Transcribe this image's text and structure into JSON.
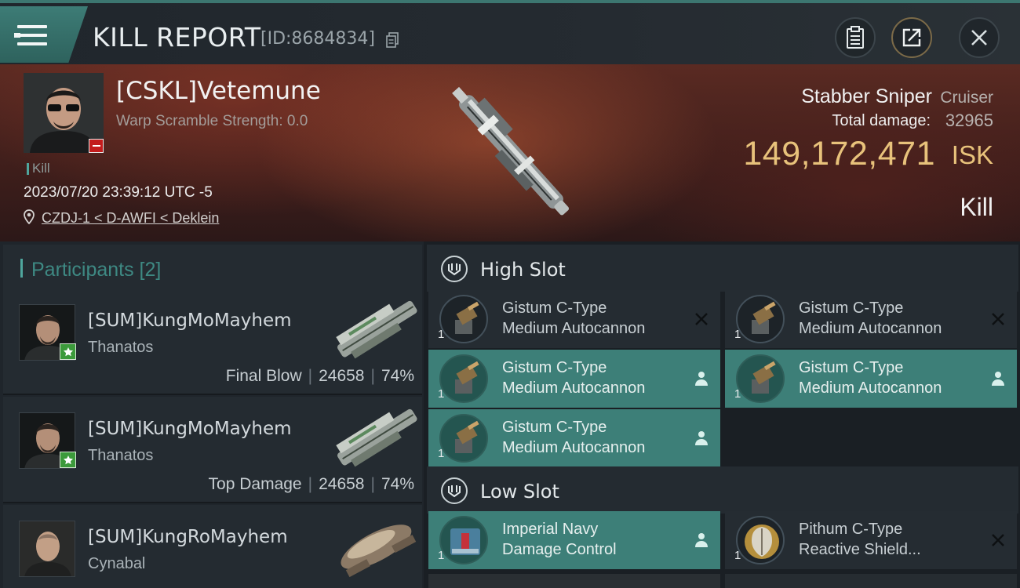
{
  "header": {
    "title": "KILL REPORT",
    "report_id": "[ID:8684834]",
    "icons": {
      "menu": "menu-icon",
      "copy": "copy-icon",
      "clipboard": "clipboard-icon",
      "share": "share-icon",
      "close": "close-icon"
    }
  },
  "victim": {
    "name": "[CSKL]Vetemune",
    "scramble": "Warp Scramble Strength: 0.0",
    "tag": "Kill",
    "datetime": "2023/07/20 23:39:12 UTC -5",
    "location": "CZDJ-1 < D-AWFI < Deklein",
    "ship_name": "Stabber Sniper",
    "ship_class": "Cruiser",
    "damage_label": "Total damage:",
    "damage_value": "32965",
    "isk_value": "149,172,471",
    "isk_unit": "ISK",
    "result": "Kill"
  },
  "participants": {
    "title": "Participants [2]",
    "rows": [
      {
        "name": "[SUM]KungMoMayhem",
        "ship": "Thanatos",
        "label": "Final Blow",
        "damage": "24658",
        "percent": "74%"
      },
      {
        "name": "[SUM]KungMoMayhem",
        "ship": "Thanatos",
        "label": "Top Damage",
        "damage": "24658",
        "percent": "74%"
      },
      {
        "name": "[SUM]KungRoMayhem",
        "ship": "Cynabal"
      }
    ]
  },
  "fitting": {
    "high_slot": {
      "title": "High Slot",
      "modules": [
        {
          "qty": "1",
          "line1": "Gistum C-Type",
          "line2": "Medium Autocannon",
          "state": "destroyed"
        },
        {
          "qty": "1",
          "line1": "Gistum C-Type",
          "line2": "Medium Autocannon",
          "state": "destroyed"
        },
        {
          "qty": "1",
          "line1": "Gistum C-Type",
          "line2": "Medium Autocannon",
          "state": "dropped"
        },
        {
          "qty": "1",
          "line1": "Gistum C-Type",
          "line2": "Medium Autocannon",
          "state": "dropped"
        },
        {
          "qty": "1",
          "line1": "Gistum C-Type",
          "line2": "Medium Autocannon",
          "state": "dropped"
        }
      ]
    },
    "low_slot": {
      "title": "Low Slot",
      "modules": [
        {
          "qty": "1",
          "line1": "Imperial Navy",
          "line2": "Damage Control",
          "state": "dropped"
        },
        {
          "qty": "1",
          "line1": "Pithum C-Type",
          "line2": "Reactive Shield...",
          "state": "destroyed"
        }
      ]
    }
  },
  "colors": {
    "accent": "#3d7f78",
    "isk": "#e8c27b",
    "badge_red": "#c31c1c",
    "star_green": "#3c9a3b"
  }
}
